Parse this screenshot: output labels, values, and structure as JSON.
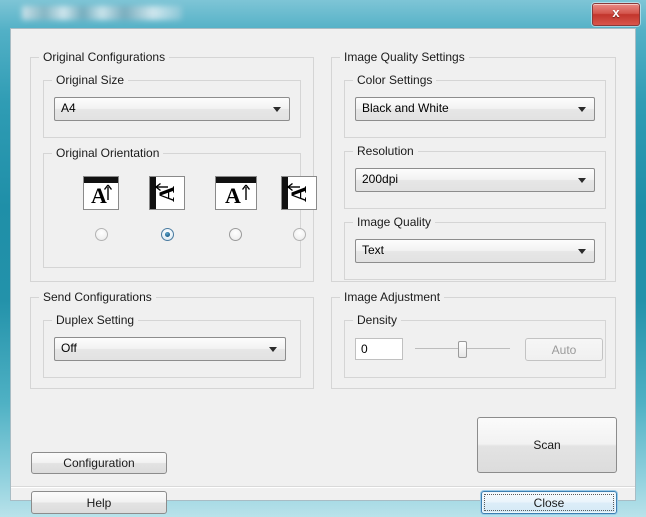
{
  "window": {
    "title": "",
    "title_redacted": true,
    "close_label": "x"
  },
  "original_configurations": {
    "legend": "Original Configurations",
    "original_size": {
      "legend": "Original Size",
      "value": "A4"
    },
    "original_orientation": {
      "legend": "Original Orientation",
      "options": [
        {
          "icon": "orientation-portrait-top-icon",
          "selected": false
        },
        {
          "icon": "orientation-landscape-left-icon",
          "selected": true
        },
        {
          "icon": "orientation-portrait-top-wide-icon",
          "selected": false
        },
        {
          "icon": "orientation-landscape-left-wide-icon",
          "selected": false
        }
      ],
      "glyph": "A"
    }
  },
  "send_configurations": {
    "legend": "Send Configurations",
    "duplex_setting": {
      "legend": "Duplex Setting",
      "value": "Off"
    }
  },
  "image_quality_settings": {
    "legend": "Image Quality Settings",
    "color_settings": {
      "legend": "Color Settings",
      "value": "Black and White"
    },
    "resolution": {
      "legend": "Resolution",
      "value": "200dpi"
    },
    "image_quality": {
      "legend": "Image Quality",
      "value": "Text"
    }
  },
  "image_adjustment": {
    "legend": "Image Adjustment",
    "density": {
      "legend": "Density",
      "value": "0",
      "slider_position_percent": 50,
      "auto_label": "Auto",
      "auto_enabled": false
    }
  },
  "actions": {
    "configuration": "Configuration",
    "scan": "Scan",
    "help": "Help",
    "close": "Close"
  },
  "colors": {
    "frame": "#2f9cb4",
    "client_bg": "#f0f0f0",
    "accent_focus": "#3c7fb1",
    "close_red": "#c2352c"
  }
}
